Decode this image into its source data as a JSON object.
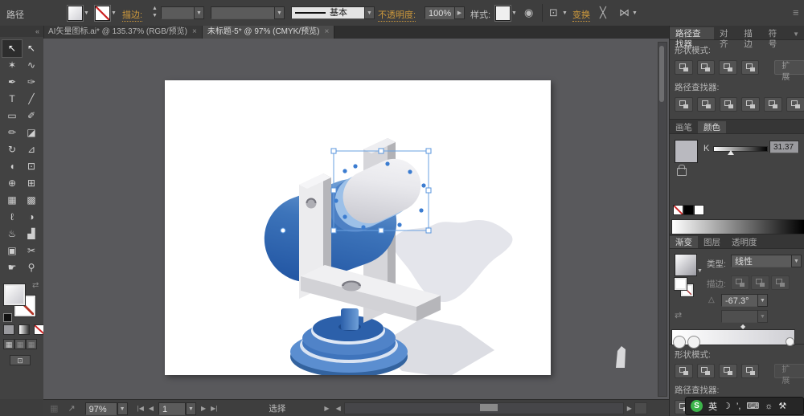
{
  "colors": {
    "gold_link": "#cf9a3c",
    "accent_blue": "#4a90d9",
    "body_blue": "#2a62ab",
    "face_gray": "#e6e6ea",
    "base_blue": "#3a70b4",
    "shadow_gray": "#e3e4ea",
    "ime_green": "#3cb44a"
  },
  "glyphs": {
    "dropdown": "▼",
    "up": "▲",
    "left": "◀",
    "right": "▶",
    "first": "|◀",
    "last": "▶|",
    "menu": "≡",
    "collapse": "«",
    "swap": "⇄",
    "angle": "△",
    "diamond": "◆",
    "circle": "◉",
    "marquee": "⊡",
    "cross": "╳",
    "bowtie": "⋈",
    "launch": "↗",
    "grid": "▦"
  },
  "control_bar": {
    "context_label": "路径",
    "stroke_link": "描边:",
    "brush_name": "基本",
    "opacity_link": "不透明度:",
    "opacity_value": "100%",
    "style_label": "样式:",
    "transform_link": "变换"
  },
  "document_tabs": [
    {
      "title": "AI矢量图标.ai* @ 135.37% (RGB/预览)",
      "close_glyph": "×"
    },
    {
      "title": "未标题-5* @ 97% (CMYK/预览)",
      "close_glyph": "×"
    }
  ],
  "toolbox": {
    "tools": [
      {
        "id": "selection",
        "glyph": "↖"
      },
      {
        "id": "direct-selection",
        "glyph": "↖"
      },
      {
        "id": "magic-wand",
        "glyph": "✶"
      },
      {
        "id": "lasso",
        "glyph": "∿"
      },
      {
        "id": "pen",
        "glyph": "✒"
      },
      {
        "id": "blob-brush",
        "glyph": "✑"
      },
      {
        "id": "type",
        "glyph": "T"
      },
      {
        "id": "line-segment",
        "glyph": "╱"
      },
      {
        "id": "rectangle",
        "glyph": "▭"
      },
      {
        "id": "paintbrush",
        "glyph": "✐"
      },
      {
        "id": "pencil",
        "glyph": "✏"
      },
      {
        "id": "eraser",
        "glyph": "◪"
      },
      {
        "id": "rotate",
        "glyph": "↻"
      },
      {
        "id": "scale",
        "glyph": "⊿"
      },
      {
        "id": "width",
        "glyph": "◖"
      },
      {
        "id": "free-transform",
        "glyph": "⊡"
      },
      {
        "id": "shape-builder",
        "glyph": "⊕"
      },
      {
        "id": "perspective-grid",
        "glyph": "⊞"
      },
      {
        "id": "mesh",
        "glyph": "▦"
      },
      {
        "id": "gradient",
        "glyph": "▩"
      },
      {
        "id": "eyedropper",
        "glyph": "ℓ"
      },
      {
        "id": "blend",
        "glyph": "◑"
      },
      {
        "id": "symbol-sprayer",
        "glyph": "♨"
      },
      {
        "id": "column-graph",
        "glyph": "▟"
      },
      {
        "id": "artboard",
        "glyph": "▣"
      },
      {
        "id": "slice",
        "glyph": "✂"
      },
      {
        "id": "hand",
        "glyph": "☛"
      },
      {
        "id": "zoom",
        "glyph": "⚲"
      }
    ]
  },
  "panels": {
    "pathfinder": {
      "tabs": [
        "路径查找器",
        "对齐",
        "描边",
        "符号"
      ],
      "shape_modes_label": "形状模式:",
      "expand_label": "扩展",
      "pathfinders_label": "路径查找器:"
    },
    "color": {
      "tabs": [
        "画笔",
        "颜色"
      ],
      "channel_label": "K",
      "channel_value": "31.37"
    },
    "gradient": {
      "tabs": [
        "渐变",
        "图层",
        "透明度"
      ],
      "type_label": "类型:",
      "type_value": "线性",
      "stroke_label": "描边:",
      "angle_value": "-67.3°"
    },
    "pathfinder_bottom": {
      "shape_modes_label": "形状模式:",
      "expand_label": "扩展",
      "pathfinders_label": "路径查找器:"
    }
  },
  "status_bar": {
    "zoom_value": "97%",
    "artboard_value": "1",
    "tool_hint": "选择"
  },
  "ime": {
    "logo_letter": "S",
    "lang_label": "英",
    "moon_glyph": "☽",
    "punct_glyph": "’,",
    "keyboard_glyph": "⌨",
    "sun_glyph": "☼",
    "tool_glyph": "⚒"
  }
}
